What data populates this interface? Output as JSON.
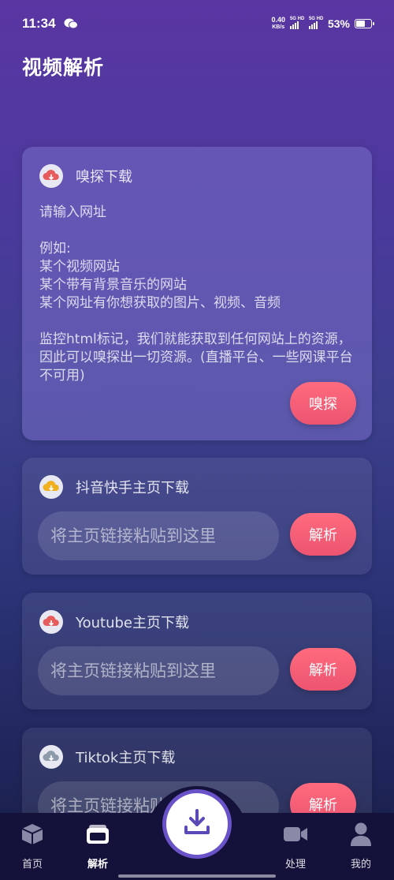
{
  "status_bar": {
    "time": "11:34",
    "net_speed_value": "0.40",
    "net_speed_unit": "KB/s",
    "sim1_label": "5G HD",
    "sim2_label": "5G HD",
    "battery": "53%"
  },
  "header": {
    "title": "视频解析"
  },
  "sniff_card": {
    "title": "嗅探下载",
    "description": "请输入网址\n\n例如:\n某个视频网站\n某个带有背景音乐的网站\n某个网址有你想获取的图片、视频、音频\n\n监控html标记，我们就能获取到任何网站上的资源，因此可以嗅探出一切资源。(直播平台、一些网课平台不可用)",
    "button": "嗅探",
    "icon_color": "#e65c5c"
  },
  "douyin_card": {
    "title": "抖音快手主页下载",
    "placeholder": "将主页链接粘贴到这里",
    "button": "解析",
    "icon_color": "#f0b020"
  },
  "youtube_card": {
    "title": "Youtube主页下载",
    "placeholder": "将主页链接粘贴到这里",
    "button": "解析",
    "icon_color": "#e65c5c"
  },
  "tiktok_card": {
    "title": "Tiktok主页下载",
    "placeholder": "将主页链接粘贴到这里",
    "button": "解析",
    "icon_color": "#8c9aaa"
  },
  "bottom_nav": {
    "items": [
      {
        "label": "首页",
        "icon": "cube-icon"
      },
      {
        "label": "解析",
        "icon": "folder-icon"
      },
      {
        "label": "处理",
        "icon": "video-camera-icon"
      },
      {
        "label": "我的",
        "icon": "person-icon"
      }
    ],
    "fab_icon": "download-icon"
  },
  "colors": {
    "accent_pink": "#f25d78",
    "fab_ring": "#6a52c8"
  }
}
